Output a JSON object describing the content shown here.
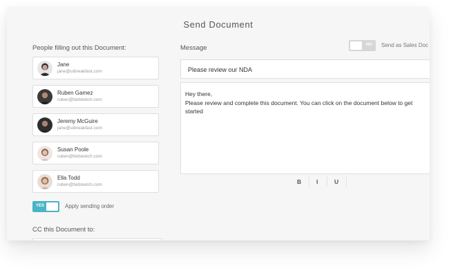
{
  "dialog": {
    "title": "Send Document"
  },
  "people": {
    "label": "People filling out this Document:",
    "items": [
      {
        "name": "Jane",
        "email": "jane@uibreakfast.com",
        "avatar_color": "#2b2b2b"
      },
      {
        "name": "Ruben Gamez",
        "email": "ruben@bidsketch.com",
        "avatar_color": "#1f1f1f"
      },
      {
        "name": "Jeremy McGuire",
        "email": "jane@uibreakfast.com",
        "avatar_color": "#262626"
      },
      {
        "name": "Susan Poole",
        "email": "ruben@bidsketch.com",
        "avatar_color": "#e8d9d2"
      },
      {
        "name": "Ella Todd",
        "email": "ruben@bidsketch.com",
        "avatar_color": "#d8c3b3"
      }
    ]
  },
  "sending_order": {
    "toggle_text": "YES",
    "label": "Apply sending order",
    "on": true,
    "color": "#49b4c5"
  },
  "cc": {
    "label": "CC this Document to:"
  },
  "message": {
    "label": "Message",
    "subject": "Please review our NDA",
    "body_lines": [
      "Hey there,",
      "Please review and complete this document. You can click on the document below to get",
      "started"
    ]
  },
  "sales_doc": {
    "toggle_text": "NO",
    "label": "Send as Sales Doc",
    "on": false
  },
  "format": {
    "bold": "B",
    "italic": "I",
    "underline": "U"
  }
}
